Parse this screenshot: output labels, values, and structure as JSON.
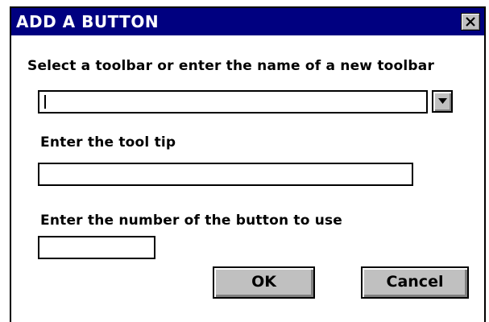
{
  "dialog": {
    "title": "ADD A BUTTON",
    "close_icon": "close-x-icon"
  },
  "toolbar_select": {
    "label": "Select a toolbar or enter the name of a new toolbar",
    "value": "",
    "dropdown_icon": "triangle-down-icon"
  },
  "tooltip_field": {
    "label": "Enter the tool tip",
    "value": ""
  },
  "button_number_field": {
    "label": "Enter the number of the button to use",
    "value": ""
  },
  "buttons": {
    "ok_label": "OK",
    "cancel_label": "Cancel"
  },
  "colors": {
    "titlebar": "#000080",
    "button_face": "#c0c0c0"
  }
}
